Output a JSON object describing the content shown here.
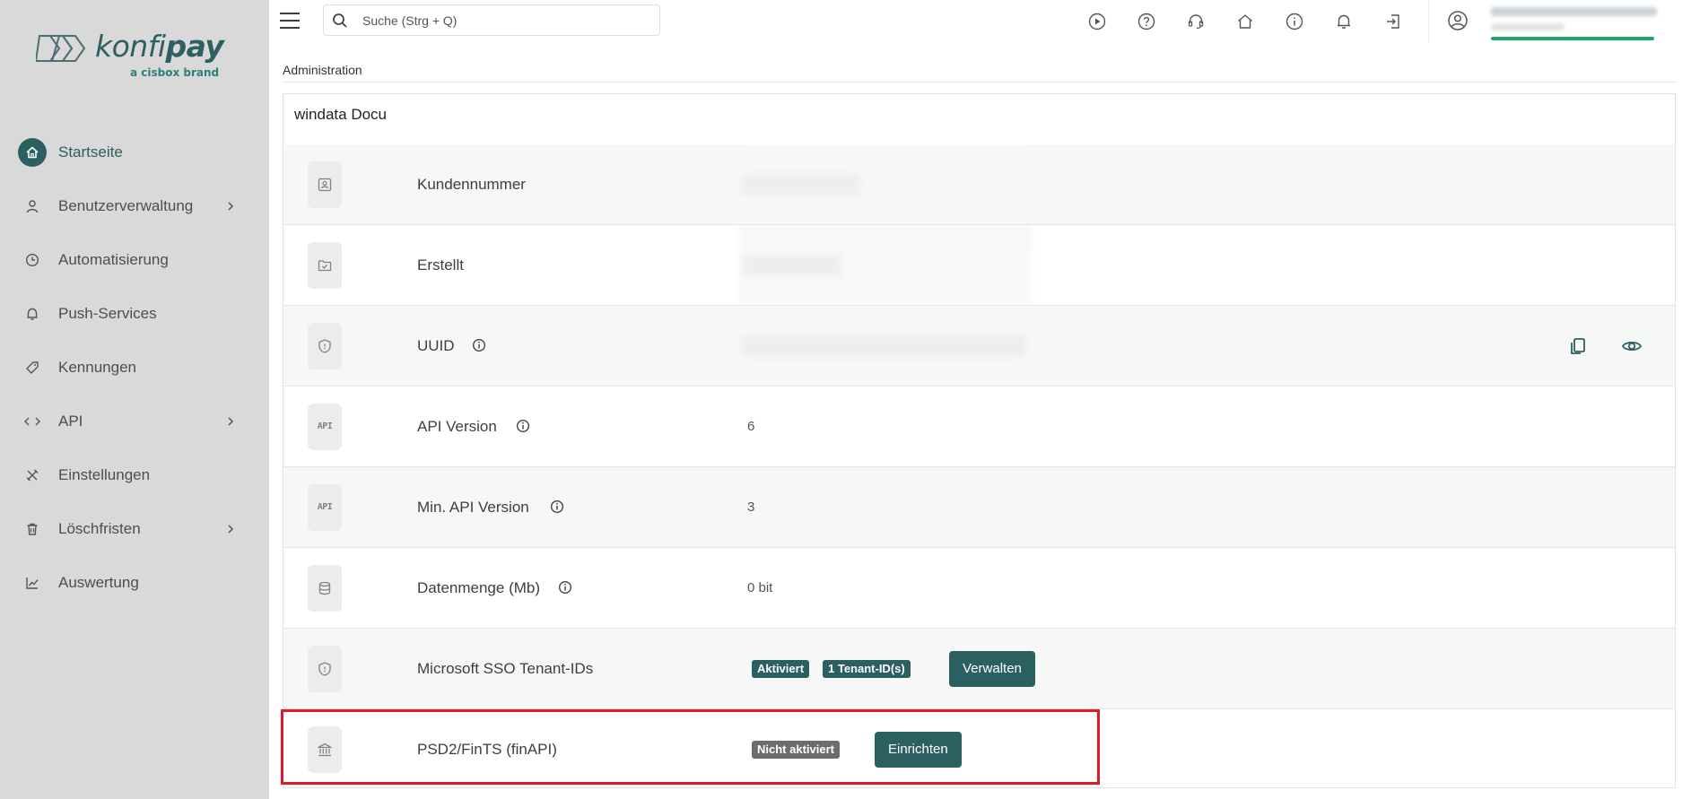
{
  "brand": {
    "name_light": "konfi",
    "name_bold": "pay",
    "tagline": "a cisbox brand"
  },
  "sidebar": {
    "items": [
      {
        "label": "Startseite",
        "icon": "home-icon",
        "active": true,
        "has_submenu": false
      },
      {
        "label": "Benutzerverwaltung",
        "icon": "user-icon",
        "active": false,
        "has_submenu": true
      },
      {
        "label": "Automatisierung",
        "icon": "clock-icon",
        "active": false,
        "has_submenu": false
      },
      {
        "label": "Push-Services",
        "icon": "bell-icon",
        "active": false,
        "has_submenu": false
      },
      {
        "label": "Kennungen",
        "icon": "tag-icon",
        "active": false,
        "has_submenu": false
      },
      {
        "label": "API",
        "icon": "code-icon",
        "active": false,
        "has_submenu": true
      },
      {
        "label": "Einstellungen",
        "icon": "tools-icon",
        "active": false,
        "has_submenu": false
      },
      {
        "label": "Löschfristen",
        "icon": "trash-icon",
        "active": false,
        "has_submenu": true
      },
      {
        "label": "Auswertung",
        "icon": "chart-icon",
        "active": false,
        "has_submenu": false
      }
    ]
  },
  "topbar": {
    "search_placeholder": "Suche (Strg + Q)",
    "icons": [
      "play-circle-icon",
      "help-icon",
      "headset-icon",
      "home-icon",
      "info-icon",
      "bell-icon",
      "logout-icon"
    ]
  },
  "breadcrumb": "Administration",
  "card": {
    "title": "windata Docu",
    "rows": [
      {
        "label": "Kundennummer",
        "icon": "id-card-icon",
        "value": "",
        "redacted": true
      },
      {
        "label": "Erstellt",
        "icon": "folder-check-icon",
        "value": "",
        "redacted": true
      },
      {
        "label": "UUID",
        "icon": "shield-icon",
        "value": "",
        "redacted": true,
        "info": true
      },
      {
        "label": "API Version",
        "icon": "api-icon",
        "icon_text": "API",
        "value": "6",
        "info": true
      },
      {
        "label": "Min. API Version",
        "icon": "api-icon",
        "icon_text": "API",
        "value": "3",
        "info": true
      },
      {
        "label": "Datenmenge (Mb)",
        "icon": "database-icon",
        "value": "0 bit",
        "info": true
      },
      {
        "label": "Microsoft SSO Tenant-IDs",
        "icon": "shield-icon",
        "badge1": "Aktiviert",
        "badge2": "1 Tenant-ID(s)",
        "button": "Verwalten"
      },
      {
        "label": "PSD2/FinTS (finAPI)",
        "icon": "bank-icon",
        "badge1": "Nicht aktiviert",
        "button": "Einrichten"
      }
    ]
  },
  "colors": {
    "accent": "#2b5f60",
    "sidebar_bg": "#d9d9d9",
    "highlight": "#e0192a",
    "progress": "#1aa86c"
  }
}
